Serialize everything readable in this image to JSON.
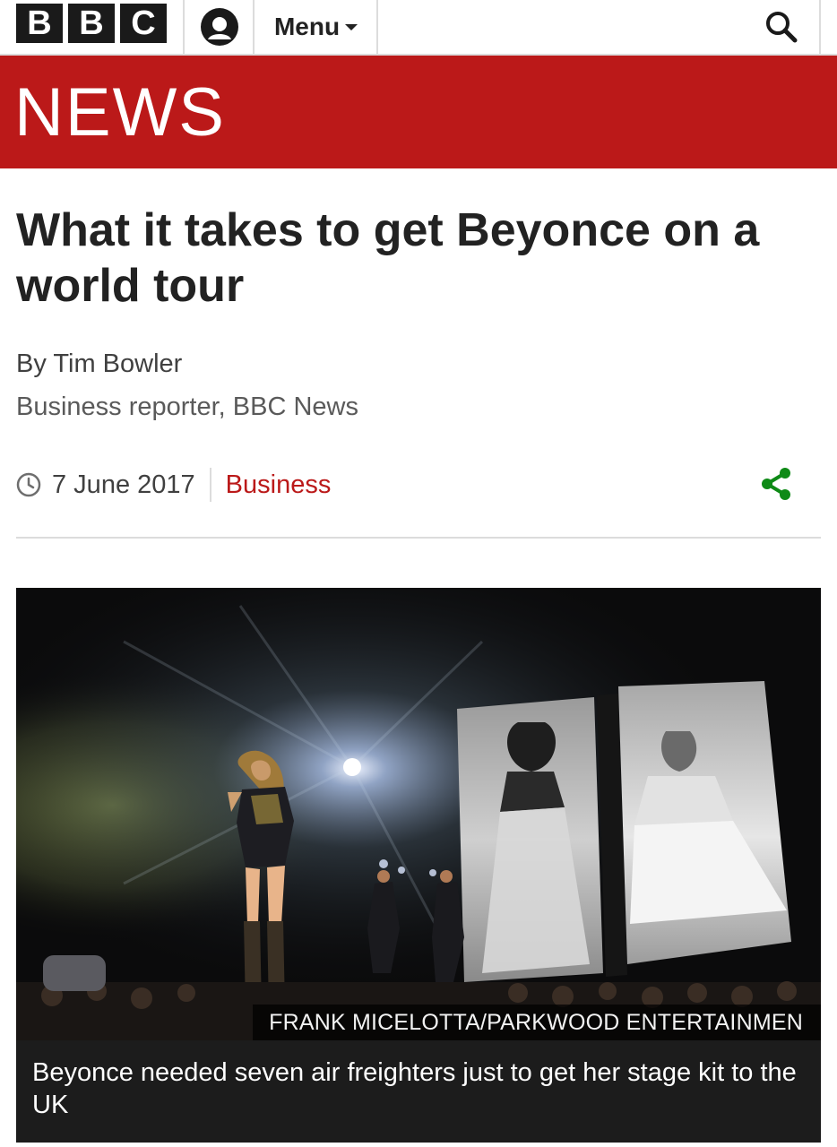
{
  "header": {
    "logo_letters": [
      "B",
      "B",
      "C"
    ],
    "account_icon": "account-icon",
    "menu_label": "Menu",
    "menu_icon": "caret-down-icon",
    "search_icon": "search-icon"
  },
  "banner": {
    "wordmark": "NEWS",
    "color": "#bb1919"
  },
  "article": {
    "headline": "What it takes to get Beyonce on a world tour",
    "byline_name": "By Tim Bowler",
    "byline_role": "Business reporter, BBC News",
    "date": "7 June 2017",
    "date_icon": "clock-icon",
    "section": "Business",
    "share_icon": "share-icon",
    "share_color": "#0e8a16"
  },
  "image": {
    "credit": "FRANK MICELOTTA/PARKWOOD ENTERTAINMEN",
    "caption": "Beyonce needed seven air freighters just to get her stage kit to the UK"
  }
}
